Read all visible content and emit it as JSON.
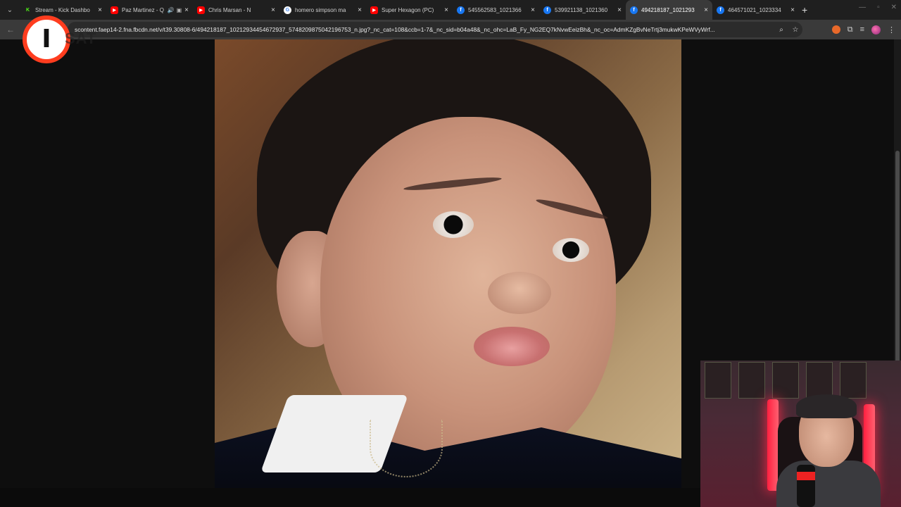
{
  "browser": {
    "tabs": [
      {
        "title": "Stream - Kick Dashbo",
        "icon": "kick-icon",
        "color": "#53fc18",
        "glyph": "K",
        "active": false,
        "muted": false
      },
      {
        "title": "Paz Martinez - Q",
        "icon": "youtube-icon",
        "color": "#ff0000",
        "glyph": "▶",
        "active": false,
        "muted": true
      },
      {
        "title": "Chris Marsan - N",
        "icon": "youtube-icon",
        "color": "#ff0000",
        "glyph": "▶",
        "active": false,
        "muted": false
      },
      {
        "title": "homero simpson ma",
        "icon": "google-icon",
        "color": "#ffffff",
        "glyph": "G",
        "active": false,
        "muted": false
      },
      {
        "title": "Super Hexagon (PC)",
        "icon": "youtube-icon",
        "color": "#ff0000",
        "glyph": "▶",
        "active": false,
        "muted": false
      },
      {
        "title": "545562583_1021366",
        "icon": "facebook-icon",
        "color": "#1877f2",
        "glyph": "f",
        "active": false,
        "muted": false
      },
      {
        "title": "539921138_1021360",
        "icon": "facebook-icon",
        "color": "#1877f2",
        "glyph": "f",
        "active": false,
        "muted": false
      },
      {
        "title": "494218187_1021293",
        "icon": "facebook-icon",
        "color": "#1877f2",
        "glyph": "f",
        "active": true,
        "muted": false
      },
      {
        "title": "464571021_1023334",
        "icon": "facebook-icon",
        "color": "#1877f2",
        "glyph": "f",
        "active": false,
        "muted": false
      }
    ],
    "new_tab_label": "+",
    "url": "scontent.faep14-2.fna.fbcdn.net/v/t39.30808-6/494218187_10212934454672937_5748209875042196753_n.jpg?_nc_cat=108&ccb=1-7&_nc_sid=b04a48&_nc_ohc=LaB_Fy_NG2EQ7kNvwEeizBh&_nc_oc=AdmKZgBvNeTrtj3mukwKPeWVyWrf..."
  },
  "overlay": {
    "logo_letter": "I",
    "logo_text": "SAT",
    "accent": "#ff3d1f"
  },
  "content": {
    "image_description_name": "child-portrait-photo"
  }
}
